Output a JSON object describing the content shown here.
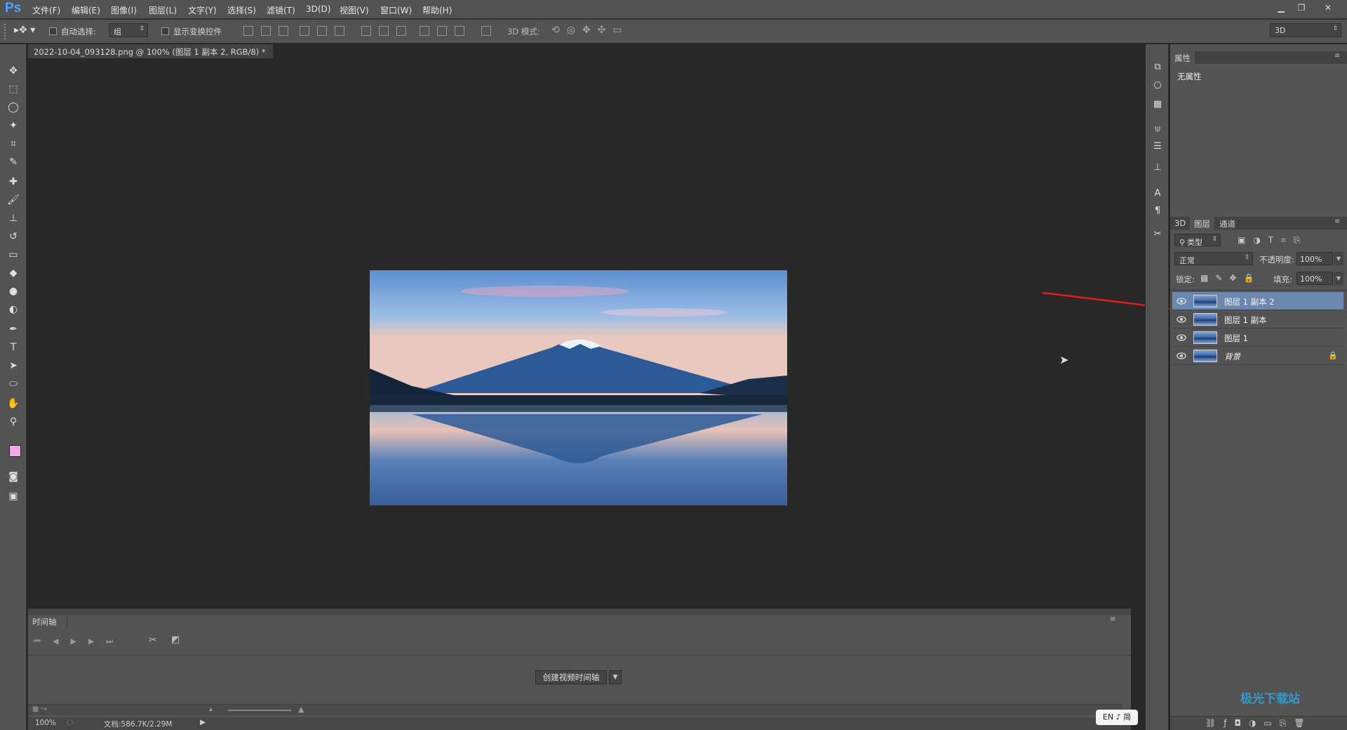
{
  "app": {
    "logo": "Ps"
  },
  "menu": [
    "文件(F)",
    "编辑(E)",
    "图像(I)",
    "图层(L)",
    "文字(Y)",
    "选择(S)",
    "滤镜(T)",
    "3D(D)",
    "视图(V)",
    "窗口(W)",
    "帮助(H)"
  ],
  "options_bar": {
    "auto_select_label": "自动选择:",
    "auto_select_value": "组",
    "show_transform_label": "显示变换控件",
    "mode_3d_label": "3D 模式:",
    "workspace_value": "3D"
  },
  "document": {
    "tab_title": "2022-10-04_093128.png @ 100% (图层 1 副本 2, RGB/8) *"
  },
  "timeline": {
    "title": "时间轴",
    "create_button": "创建视频时间轴"
  },
  "status": {
    "zoom": "100%",
    "doc_info": "文档:586.7K/2.29M"
  },
  "ime": {
    "text": "EN ♪ 简"
  },
  "properties": {
    "tab": "属性",
    "content": "无属性"
  },
  "layers_panel": {
    "tabs": [
      "3D",
      "图层",
      "通道"
    ],
    "filter_label": "类型",
    "blend_mode": "正常",
    "opacity_label": "不透明度:",
    "opacity_value": "100%",
    "lock_label": "锁定:",
    "fill_label": "填充:",
    "fill_value": "100%",
    "layers": [
      {
        "name": "图层 1 副本 2",
        "active": true,
        "locked": false
      },
      {
        "name": "图层 1 副本",
        "active": false,
        "locked": false
      },
      {
        "name": "图层 1",
        "active": false,
        "locked": false
      },
      {
        "name": "背景",
        "active": false,
        "locked": true
      }
    ]
  },
  "watermark": {
    "text": "极光下载站"
  },
  "colors": {
    "foreground": "#f0a8e8",
    "background": "#ffffff",
    "annotation_arrow": "#e02020",
    "active_layer": "#6c87ad"
  }
}
